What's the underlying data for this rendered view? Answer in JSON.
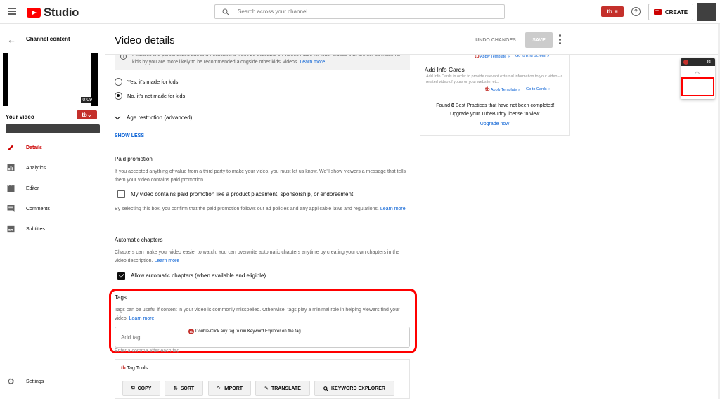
{
  "header": {
    "app_name": "Studio",
    "search_placeholder": "Search across your channel",
    "create_label": "CREATE",
    "help_label": "?"
  },
  "sidebar": {
    "back_label": "Channel content",
    "video_duration": "0:09",
    "your_video_label": "Your video",
    "nav": [
      {
        "label": "Details",
        "icon": "pencil-icon",
        "active": true
      },
      {
        "label": "Analytics",
        "icon": "analytics-icon"
      },
      {
        "label": "Editor",
        "icon": "editor-icon"
      },
      {
        "label": "Comments",
        "icon": "comments-icon"
      },
      {
        "label": "Subtitles",
        "icon": "subtitles-icon"
      }
    ],
    "settings_label": "Settings"
  },
  "main": {
    "title": "Video details",
    "undo_label": "UNDO CHANGES",
    "save_label": "SAVE",
    "info_text": "Features like personalized ads and notifications won't be available on videos made for kids. Videos that are set as made for kids by you are more likely to be recommended alongside other kids' videos.",
    "info_link": "Learn more",
    "audience": {
      "yes_label": "Yes, it's made for kids",
      "no_label": "No, it's not made for kids",
      "selected": "no"
    },
    "age_restriction_label": "Age restriction (advanced)",
    "show_less_label": "SHOW LESS",
    "paid_promotion": {
      "title": "Paid promotion",
      "description": "If you accepted anything of value from a third party to make your video, you must let us know. We'll show viewers a message that tells them your video contains paid promotion.",
      "checkbox_label": "My video contains paid promotion like a product placement, sponsorship, or endorsement",
      "checked": false,
      "footnote": "By selecting this box, you confirm that the paid promotion follows our ad policies and any applicable laws and regulations.",
      "footnote_link": "Learn more"
    },
    "chapters": {
      "title": "Automatic chapters",
      "description": "Chapters can make your video easier to watch. You can overwrite automatic chapters anytime by creating your own chapters in the video description.",
      "link": "Learn more",
      "checkbox_label": "Allow automatic chapters (when available and eligible)",
      "checked": true
    },
    "tags": {
      "title": "Tags",
      "description": "Tags can be useful if content in your video is commonly misspelled. Otherwise, tags play a minimal role in helping viewers find your video.",
      "link": "Learn more",
      "hint": "Double-Click any tag to run Keyword Explorer on the tag.",
      "placeholder": "Add tag",
      "helper": "Enter a comma after each tag"
    },
    "tag_tools": {
      "title": "Tag Tools",
      "buttons": [
        "COPY",
        "SORT",
        "IMPORT",
        "TRANSLATE",
        "KEYWORD EXPLORER"
      ]
    }
  },
  "right_panel": {
    "apply_template": "Apply Template »",
    "go_end_screen": "Go to End Screen »",
    "info_cards_title": "Add Info Cards",
    "info_cards_desc": "Add Info Cards in order to provide relevant external information to your video - a related video of yours or your website, etc.",
    "apply_template_2": "Apply Template »",
    "go_cards": "Go to Cards »",
    "found_prefix": "Found",
    "found_count": "8",
    "found_suffix": "Best Practices that have not been completed!",
    "upgrade_text": "Upgrade your TubeBuddy license to view.",
    "upgrade_link": "Upgrade now!"
  },
  "colors": {
    "accent": "#c4302b",
    "highlight": "#ff0000",
    "link": "#065fd4"
  }
}
